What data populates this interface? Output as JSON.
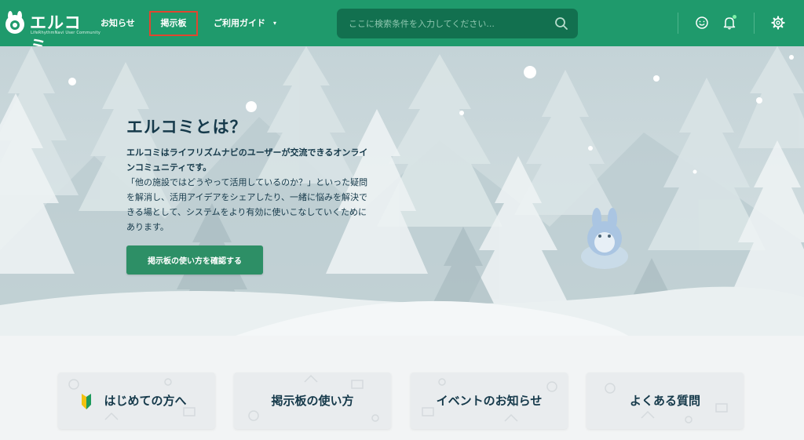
{
  "header": {
    "logo_text": "エルコミ",
    "logo_sub": "LifeRhythmNavi User Community",
    "nav": [
      {
        "label": "お知らせ"
      },
      {
        "label": "掲示板"
      },
      {
        "label": "ご利用ガイド"
      }
    ],
    "search": {
      "placeholder": "ここに検索条件を入力してください..."
    },
    "icons": [
      "smile-icon",
      "bell-icon",
      "gear-icon"
    ]
  },
  "hero": {
    "title": "エルコミとは？",
    "lead": "エルコミはライフリズムナビのユーザーが交流できるオンラインコミュニティです。",
    "body": "「他の施設ではどうやって活用しているのか？」といった疑問を解消し、活用アイデアをシェアしたり、一緒に悩みを解決できる場として、システムをより有効に使いこなしていくためにあります。",
    "button": "掲示板の使い方を確認する"
  },
  "cards": [
    {
      "label": "はじめての方へ"
    },
    {
      "label": "掲示板の使い方"
    },
    {
      "label": "イベントのお知らせ"
    },
    {
      "label": "よくある質問"
    }
  ],
  "colors": {
    "header": "#1f9a6c",
    "search_bg": "#12704f",
    "highlight": "#e2452f",
    "button": "#2d8f66",
    "text_dark": "#15394a"
  }
}
